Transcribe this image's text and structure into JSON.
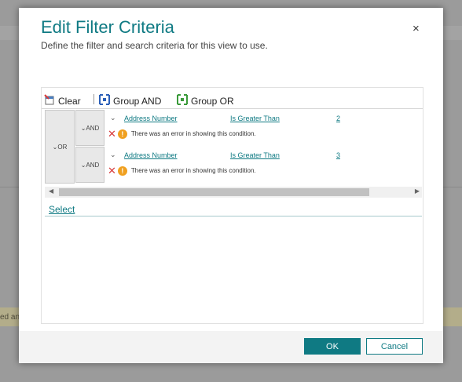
{
  "background": {
    "status_fragment": "ed and"
  },
  "dialog": {
    "title": "Edit Filter Criteria",
    "subtitle": "Define the filter and search criteria for this view to use.",
    "close_glyph": "×",
    "toolbar": {
      "clear_label": "Clear",
      "group_and_label": "Group AND",
      "group_or_label": "Group OR"
    },
    "group": {
      "outer_operator": "OR",
      "conditions": [
        {
          "operator": "AND",
          "field": "Address Number",
          "comparison": "Is Greater Than",
          "value": "2",
          "error": "There was an error in showing this condition."
        },
        {
          "operator": "AND",
          "field": "Address Number",
          "comparison": "Is Greater Than",
          "value": "3",
          "error": "There was an error in showing this condition."
        }
      ]
    },
    "select_label": "Select",
    "footer": {
      "ok_label": "OK",
      "cancel_label": "Cancel"
    }
  },
  "colors": {
    "accent": "#0f7a83",
    "error": "#d83b3b",
    "warning": "#f0a020"
  }
}
